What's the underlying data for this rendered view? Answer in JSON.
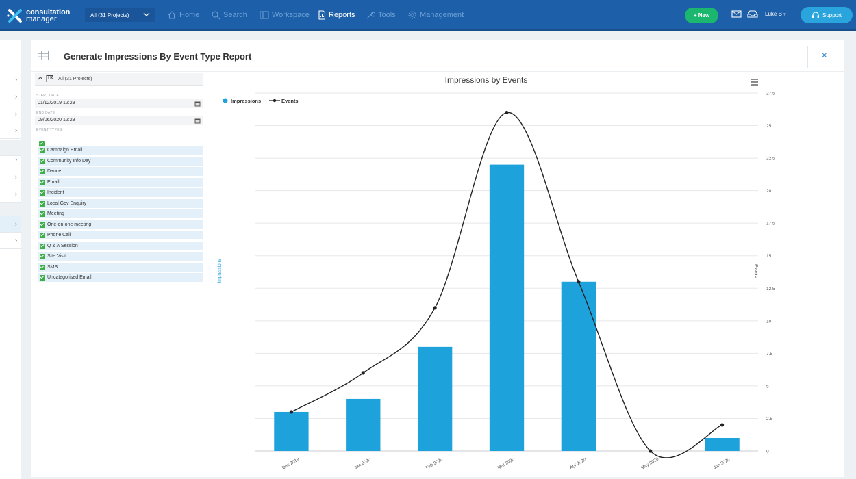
{
  "topbar": {
    "logo_line1": "consultation",
    "logo_line2": "manager",
    "project_select": "All (31 Projects)",
    "nav": [
      {
        "label": "Home",
        "icon": "home-icon"
      },
      {
        "label": "Search",
        "icon": "search-icon"
      },
      {
        "label": "Workspace",
        "icon": "workspace-icon"
      },
      {
        "label": "Reports",
        "icon": "reports-icon",
        "active": true
      },
      {
        "label": "Tools",
        "icon": "tools-icon"
      },
      {
        "label": "Management",
        "icon": "gear-icon"
      }
    ],
    "new_label": "+ New",
    "user_name": "Luke B",
    "support_label": "Support",
    "colors": {
      "bar": "#1d5fa8",
      "new": "#1bb76e",
      "support": "#29a4dd"
    }
  },
  "panel": {
    "title": "Generate Impressions By Event Type Report",
    "close": "×"
  },
  "filters": {
    "project_scope": "All (31 Projects)",
    "start_date_label": "START DATE",
    "start_date": "01/12/2019 12:29",
    "end_date_label": "END DATE",
    "end_date": "09/06/2020 12:29",
    "event_types_label": "EVENT TYPES",
    "event_types": [
      "Campaign Email",
      "Community Info Day",
      "Dance",
      "Email",
      "Incident",
      "Local Gov Enquiry",
      "Meeting",
      "One-on-one meeting",
      "Phone Call",
      "Q & A Session",
      "Site Visit",
      "SMS",
      "Uncategorised Email"
    ]
  },
  "chart_data": {
    "type": "bar",
    "title": "Impressions by Events",
    "categories": [
      "Dec 2019",
      "Jan 2020",
      "Feb 2020",
      "Mar 2020",
      "Apr 2020",
      "May 2020",
      "Jun 2020"
    ],
    "series": [
      {
        "name": "Impressions",
        "type": "bar",
        "axis": "left",
        "color": "#1ea2dc",
        "values": [
          3,
          4,
          8,
          22,
          13,
          0,
          1
        ]
      },
      {
        "name": "Events",
        "type": "line",
        "axis": "right",
        "color": "#222222",
        "values": [
          3,
          6,
          11,
          26,
          13,
          0,
          2
        ]
      }
    ],
    "ylabel": "Impressions",
    "y2label": "Events",
    "ylim": [
      0,
      27.5
    ],
    "yticks": [
      "0",
      "2.5",
      "5",
      "7.5",
      "10",
      "12.5",
      "15",
      "17.5",
      "20",
      "22.5",
      "25",
      "27.5"
    ],
    "legend": "top-left",
    "grid": true
  }
}
